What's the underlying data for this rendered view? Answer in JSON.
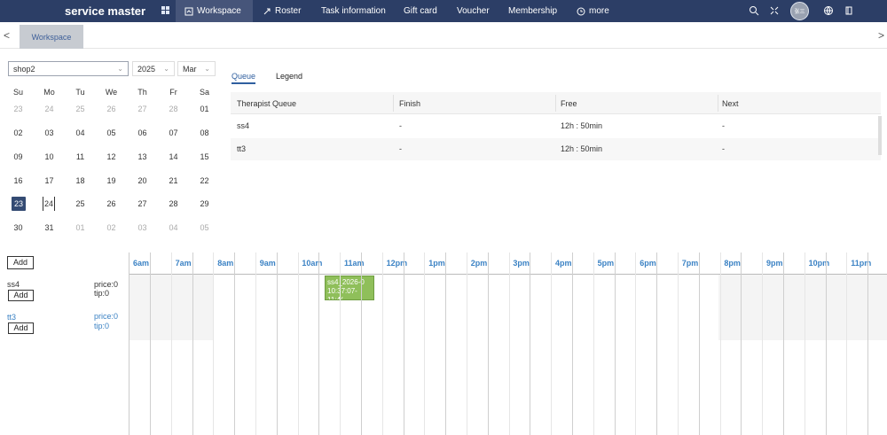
{
  "header": {
    "brand": "service master",
    "nav": [
      {
        "label": "Workspace",
        "icon": "workspace-icon",
        "active": true
      },
      {
        "label": "Roster",
        "icon": "roster-icon",
        "active": false
      },
      {
        "label": "Task information",
        "icon": "",
        "active": false
      },
      {
        "label": "Gift card",
        "icon": "",
        "active": false
      },
      {
        "label": "Voucher",
        "icon": "",
        "active": false
      },
      {
        "label": "Membership",
        "icon": "",
        "active": false
      },
      {
        "label": "more",
        "icon": "more-icon",
        "active": false
      }
    ],
    "avatar": "张三"
  },
  "tabs": {
    "left": "<",
    "workspace": "Workspace",
    "right": ">"
  },
  "filters": {
    "shop": "shop2",
    "year": "2025",
    "month": "Mar"
  },
  "calendar": {
    "weekdays": [
      "Su",
      "Mo",
      "Tu",
      "We",
      "Th",
      "Fr",
      "Sa"
    ],
    "weeks": [
      [
        "23",
        "24",
        "25",
        "26",
        "27",
        "28",
        "01"
      ],
      [
        "02",
        "03",
        "04",
        "05",
        "06",
        "07",
        "08"
      ],
      [
        "09",
        "10",
        "11",
        "12",
        "13",
        "14",
        "15"
      ],
      [
        "16",
        "17",
        "18",
        "19",
        "20",
        "21",
        "22"
      ],
      [
        "23",
        "24",
        "25",
        "26",
        "27",
        "28",
        "29"
      ],
      [
        "30",
        "31",
        "01",
        "02",
        "03",
        "04",
        "05"
      ]
    ],
    "muted_first_row": 6,
    "muted_last_row": 5
  },
  "queue": {
    "tabs": [
      "Queue",
      "Legend"
    ],
    "headers": [
      "Therapist Queue",
      "Finish",
      "Free",
      "Next"
    ],
    "rows": [
      [
        "ss4",
        "-",
        "12h : 50min",
        "-"
      ],
      [
        "tt3",
        "-",
        "12h : 50min",
        "-"
      ]
    ]
  },
  "schedule": {
    "top_add": "Add",
    "staff": [
      {
        "name": "ss4",
        "price": "price:0",
        "tip": "tip:0",
        "add": "Add"
      },
      {
        "name": "tt3",
        "price": "price:0",
        "tip": "tip:0",
        "add": "Add"
      }
    ],
    "hours": [
      "6am",
      "7am",
      "8am",
      "9am",
      "10am",
      "11am",
      "12pm",
      "1pm",
      "2pm",
      "3pm",
      "4pm",
      "5pm",
      "6pm",
      "7pm",
      "8pm",
      "9pm",
      "10pm",
      "11pm"
    ],
    "booking": {
      "title": "ss4_2026-0",
      "time": "10:37:07-11:4("
    }
  },
  "colors": {
    "topbar": "#2c3e66",
    "active_nav": "#46557a",
    "accent": "#3b82c4",
    "selected_day": "#344b73",
    "booking": "#8fbf5a"
  }
}
